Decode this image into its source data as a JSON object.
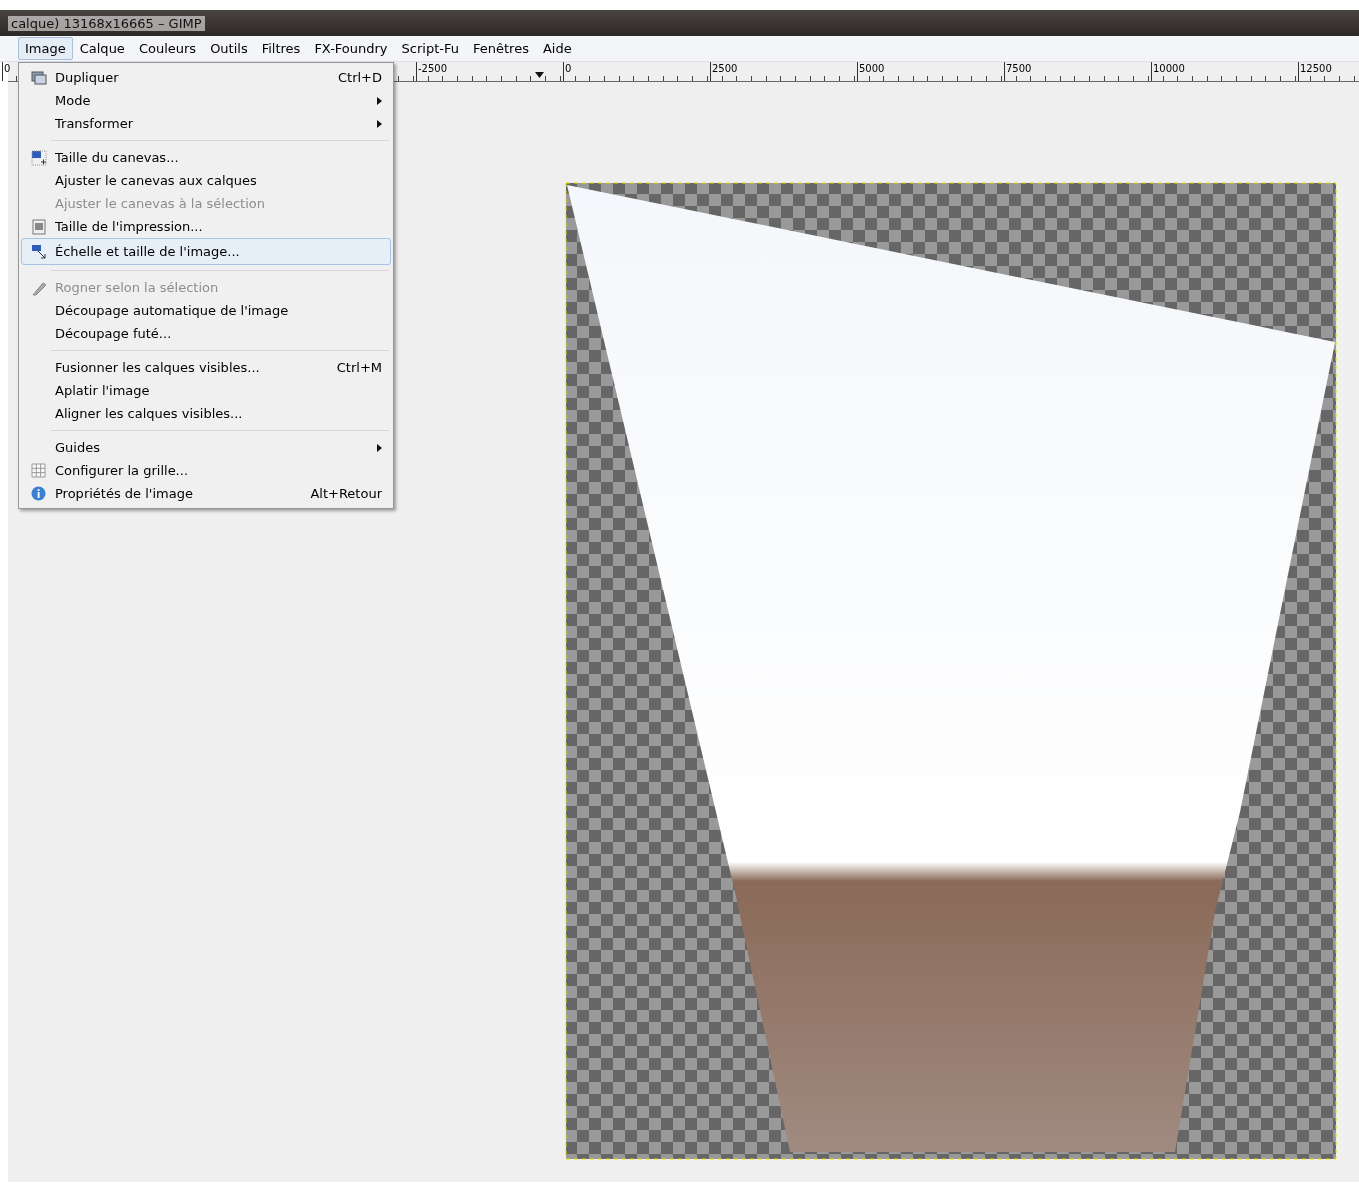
{
  "window": {
    "title": "calque) 13168x16665 – GIMP"
  },
  "menubar": [
    {
      "label": "Image",
      "selected": true
    },
    {
      "label": "Calque",
      "selected": false
    },
    {
      "label": "Couleurs",
      "selected": false
    },
    {
      "label": "Outils",
      "selected": false
    },
    {
      "label": "Filtres",
      "selected": false
    },
    {
      "label": "FX-Foundry",
      "selected": false
    },
    {
      "label": "Script-Fu",
      "selected": false
    },
    {
      "label": "Fenêtres",
      "selected": false
    },
    {
      "label": "Aide",
      "selected": false
    }
  ],
  "ruler": {
    "labels": [
      "0",
      "-2500",
      "0",
      "2500",
      "5000",
      "7500",
      "10000",
      "12500"
    ]
  },
  "image_menu": {
    "items": [
      {
        "kind": "item",
        "label": "Dupliquer",
        "shortcut": "Ctrl+D",
        "submenu": false,
        "disabled": false,
        "selected": false
      },
      {
        "kind": "item",
        "label": "Mode",
        "submenu": true,
        "disabled": false,
        "selected": false
      },
      {
        "kind": "item",
        "label": "Transformer",
        "submenu": true,
        "disabled": false,
        "selected": false
      },
      {
        "kind": "separator"
      },
      {
        "kind": "item",
        "label": "Taille du canevas...",
        "submenu": false,
        "disabled": false,
        "selected": false
      },
      {
        "kind": "item",
        "label": "Ajuster le canevas aux calques",
        "submenu": false,
        "disabled": false,
        "selected": false
      },
      {
        "kind": "item",
        "label": "Ajuster le canevas à la sélection",
        "submenu": false,
        "disabled": true,
        "selected": false
      },
      {
        "kind": "item",
        "label": "Taille de l'impression...",
        "submenu": false,
        "disabled": false,
        "selected": false
      },
      {
        "kind": "item",
        "label": "Échelle et taille de l'image...",
        "submenu": false,
        "disabled": false,
        "selected": true
      },
      {
        "kind": "separator"
      },
      {
        "kind": "item",
        "label": "Rogner selon la sélection",
        "submenu": false,
        "disabled": true,
        "selected": false
      },
      {
        "kind": "item",
        "label": "Découpage automatique de l'image",
        "submenu": false,
        "disabled": false,
        "selected": false
      },
      {
        "kind": "item",
        "label": "Découpage futé...",
        "submenu": false,
        "disabled": false,
        "selected": false
      },
      {
        "kind": "separator"
      },
      {
        "kind": "item",
        "label": "Fusionner les calques visibles...",
        "shortcut": "Ctrl+M",
        "submenu": false,
        "disabled": false,
        "selected": false
      },
      {
        "kind": "item",
        "label": "Aplatir l'image",
        "submenu": false,
        "disabled": false,
        "selected": false
      },
      {
        "kind": "item",
        "label": "Aligner les calques visibles...",
        "submenu": false,
        "disabled": false,
        "selected": false
      },
      {
        "kind": "separator"
      },
      {
        "kind": "item",
        "label": "Guides",
        "submenu": true,
        "disabled": false,
        "selected": false
      },
      {
        "kind": "item",
        "label": "Configurer la grille...",
        "submenu": false,
        "disabled": false,
        "selected": false
      },
      {
        "kind": "item",
        "label": "Propriétés de l'image",
        "shortcut": "Alt+Retour",
        "submenu": false,
        "disabled": false,
        "selected": false
      }
    ]
  }
}
